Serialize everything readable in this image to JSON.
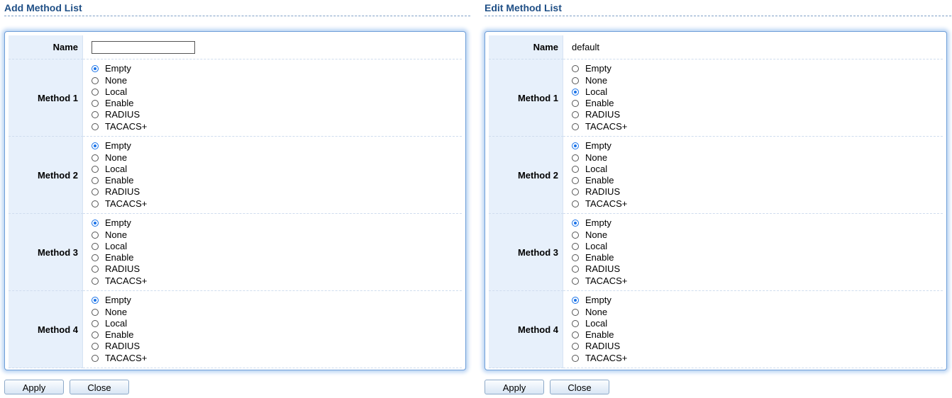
{
  "radio_options": [
    "Empty",
    "None",
    "Local",
    "Enable",
    "RADIUS",
    "TACACS+"
  ],
  "add": {
    "title": "Add Method List",
    "name_label": "Name",
    "name_value": "",
    "methods": [
      {
        "label": "Method 1",
        "selected": "Empty"
      },
      {
        "label": "Method 2",
        "selected": "Empty"
      },
      {
        "label": "Method 3",
        "selected": "Empty"
      },
      {
        "label": "Method 4",
        "selected": "Empty"
      }
    ],
    "apply_label": "Apply",
    "close_label": "Close"
  },
  "edit": {
    "title": "Edit Method List",
    "name_label": "Name",
    "name_value": "default",
    "methods": [
      {
        "label": "Method 1",
        "selected": "Local"
      },
      {
        "label": "Method 2",
        "selected": "Empty"
      },
      {
        "label": "Method 3",
        "selected": "Empty"
      },
      {
        "label": "Method 4",
        "selected": "Empty"
      }
    ],
    "apply_label": "Apply",
    "close_label": "Close"
  },
  "colors": {
    "title": "#1f4f86",
    "label_bg": "#e7f0fb",
    "panel_border": "#6f9fd8",
    "radio_selected": "#1a73e8"
  }
}
